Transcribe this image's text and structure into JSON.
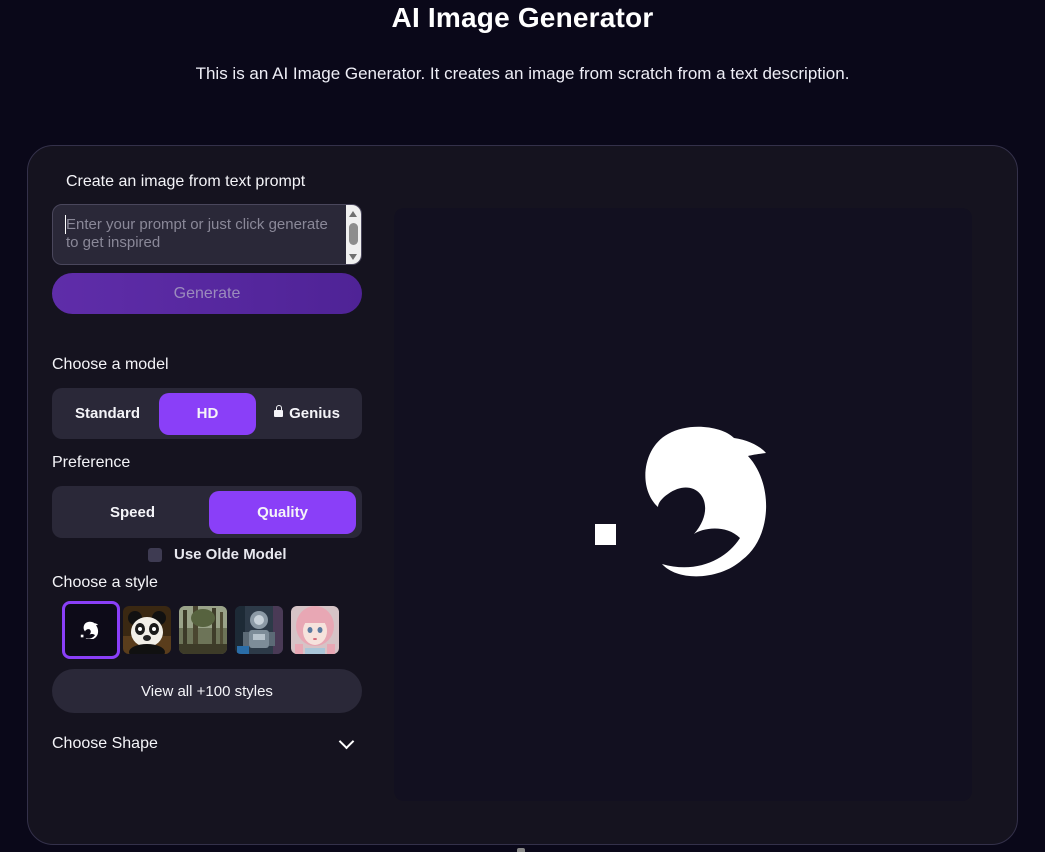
{
  "header": {
    "title": "AI Image Generator",
    "subtitle": "This is an AI Image Generator. It creates an image from scratch from a text description."
  },
  "prompt": {
    "label": "Create an image from text prompt",
    "placeholder": "Enter your prompt or just click generate to get inspired",
    "value": ""
  },
  "generate_label": "Generate",
  "model": {
    "label": "Choose a model",
    "options": [
      "Standard",
      "HD",
      "Genius"
    ],
    "selected": "HD",
    "locked": "Genius"
  },
  "preference": {
    "label": "Preference",
    "options": [
      "Speed",
      "Quality"
    ],
    "selected": "Quality"
  },
  "olde_model": {
    "label": "Use Olde Model",
    "checked": false
  },
  "style": {
    "label": "Choose a style",
    "thumbnails": [
      "logo-style",
      "panda-style",
      "forest-style",
      "robot-style",
      "anime-girl-style"
    ],
    "selected": "logo-style",
    "view_all_label": "View all +100 styles"
  },
  "shape": {
    "label": "Choose Shape",
    "icon": "chevron-down-icon"
  },
  "preview": {
    "icon": "dolphin-logo-icon"
  },
  "colors": {
    "accent": "#8a3ff8",
    "generate_button": "#5a2aa3",
    "card_background": "#15131f",
    "page_background": "#0a0819"
  }
}
